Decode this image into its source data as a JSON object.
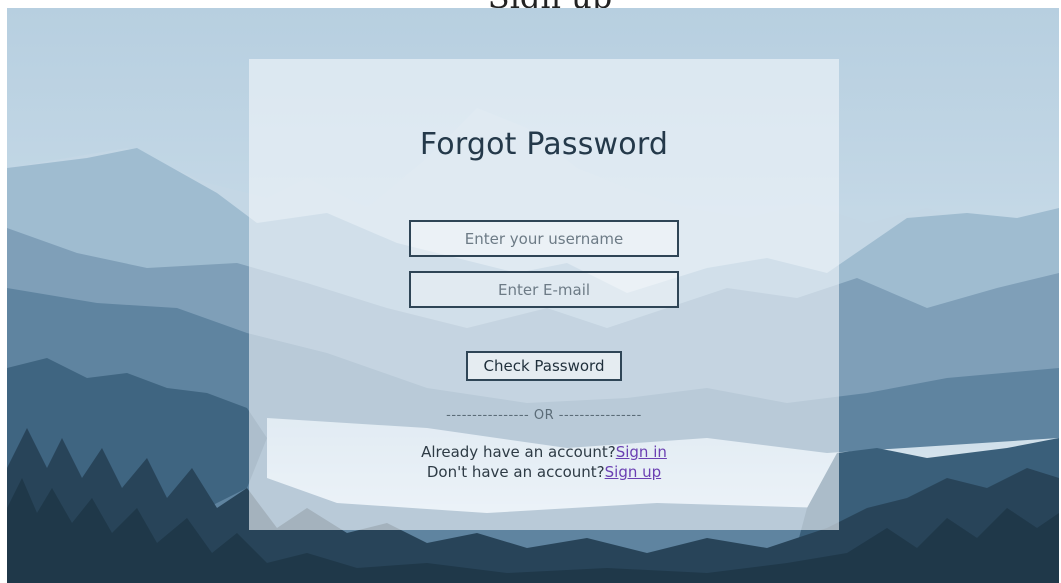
{
  "header": {
    "cutoff_text": "Sign up"
  },
  "form": {
    "title": "Forgot Password",
    "username_placeholder": "Enter your username",
    "email_placeholder": "Enter E-mail",
    "submit_label": "Check Password",
    "divider": "---------------- OR ----------------",
    "signin_prompt": "Already have an account?",
    "signin_link": "Sign in",
    "signup_prompt": "Don't have an account?",
    "signup_link": "Sign up"
  },
  "colors": {
    "sky": "#b9d2e3",
    "mountain_far": "#8fb1c8",
    "mountain_mid": "#6f93ad",
    "forest": "#2c4a60",
    "text": "#24394a",
    "link": "#6a3fb2"
  }
}
